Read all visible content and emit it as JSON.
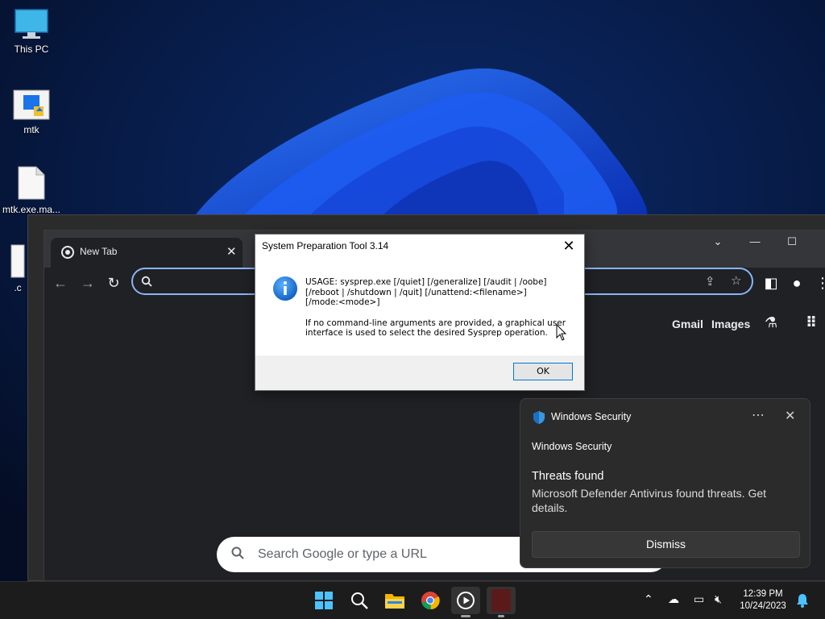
{
  "desktop": {
    "icons": [
      {
        "label": "This PC",
        "icon": "monitor-icon"
      },
      {
        "label": "mtk",
        "icon": "folder-icon"
      },
      {
        "label": "mtk.exe.ma...",
        "icon": "file-icon"
      },
      {
        "label": ".c",
        "icon": "file-icon"
      }
    ]
  },
  "browser": {
    "tab_title": "New Tab",
    "links": [
      "Gmail",
      "Images"
    ],
    "search_placeholder": "Search Google or type a URL",
    "accent_color": "#8ab4f8"
  },
  "dialog": {
    "title": "System Preparation Tool 3.14",
    "usage_line1": "USAGE: sysprep.exe [/quiet] [/generalize] [/audit | /oobe]",
    "usage_line2": "[/reboot | /shutdown | /quit] [/unattend:<filename>]",
    "usage_line3": "[/mode:<mode>]",
    "info_line1": "If no command-line arguments are provided, a graphical user",
    "info_line2": "interface is used to select the desired Sysprep operation.",
    "ok_label": "OK",
    "close_glyph": "✕"
  },
  "toast": {
    "app_name": "Windows Security",
    "attribution": "Windows Security",
    "heading": "Threats found",
    "body": "Microsoft Defender Antivirus found threats. Get details.",
    "button_label": "Dismiss",
    "more_glyph": "⋯",
    "close_glyph": "✕"
  },
  "taskbar": {
    "apps": [
      "start-icon",
      "search-icon",
      "file-explorer-icon",
      "chrome-icon",
      "media-player-icon",
      "app-icon"
    ],
    "time": "12:39 PM",
    "date": "10/24/2023"
  }
}
